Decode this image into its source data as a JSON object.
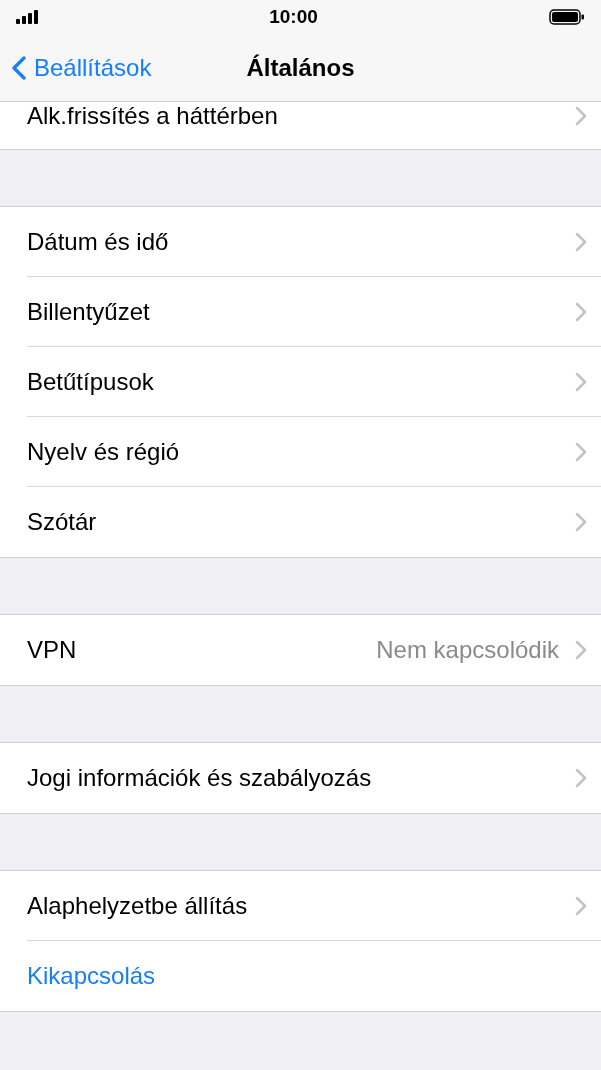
{
  "status_bar": {
    "time": "10:00"
  },
  "nav": {
    "back": "Beállítások",
    "title": "Általános"
  },
  "groups": [
    {
      "cut": true,
      "rows": [
        {
          "label": "Alk.frissítés a háttérben",
          "kind": "link"
        }
      ]
    },
    {
      "cut": false,
      "rows": [
        {
          "label": "Dátum és idő",
          "kind": "link"
        },
        {
          "label": "Billentyűzet",
          "kind": "link"
        },
        {
          "label": "Betűtípusok",
          "kind": "link"
        },
        {
          "label": "Nyelv és régió",
          "kind": "link"
        },
        {
          "label": "Szótár",
          "kind": "link"
        }
      ]
    },
    {
      "cut": false,
      "rows": [
        {
          "label": "VPN",
          "value": "Nem kapcsolódik",
          "kind": "link"
        }
      ]
    },
    {
      "cut": false,
      "rows": [
        {
          "label": "Jogi információk és szabályozás",
          "kind": "link"
        }
      ]
    },
    {
      "cut": false,
      "rows": [
        {
          "label": "Alaphelyzetbe állítás",
          "kind": "link"
        },
        {
          "label": "Kikapcsolás",
          "kind": "action"
        }
      ]
    }
  ]
}
